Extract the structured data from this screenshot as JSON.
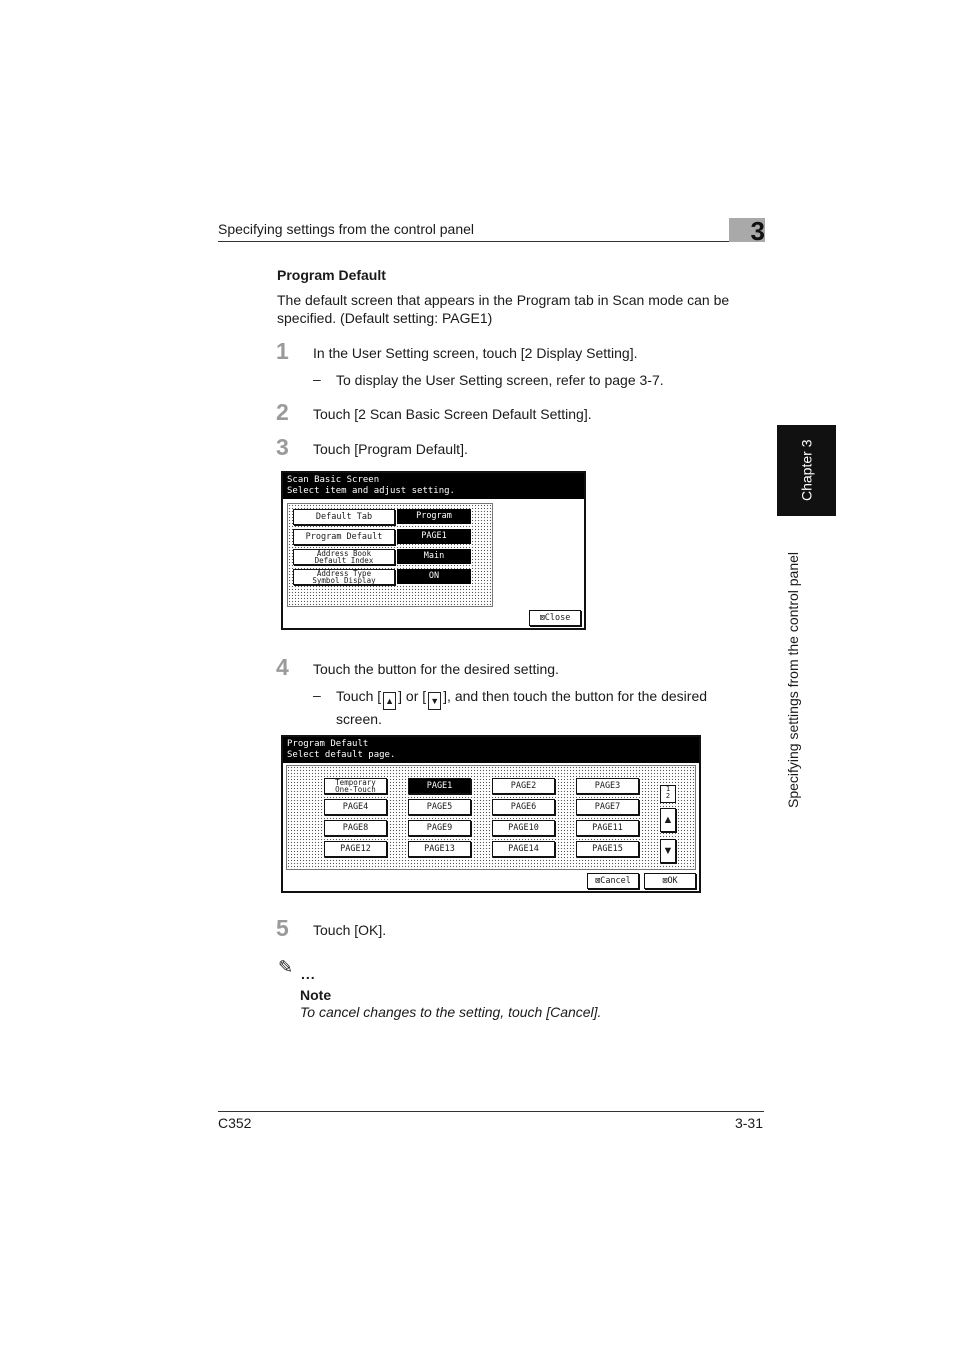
{
  "header": {
    "title": "Specifying settings from the control panel",
    "chapter_number": "3"
  },
  "side_tab": {
    "chapter_label": "Chapter 3",
    "section_label": "Specifying settings from the control panel"
  },
  "section": {
    "title": "Program Default",
    "intro": "The default screen that appears in the Program tab in Scan mode can be specified. (Default setting: PAGE1)"
  },
  "steps": [
    {
      "num": "1",
      "text": "In the User Setting screen, touch [2 Display Setting].",
      "sub": "To display the User Setting screen, refer to page 3-7."
    },
    {
      "num": "2",
      "text": "Touch [2 Scan Basic Screen Default Setting]."
    },
    {
      "num": "3",
      "text": "Touch [Program Default]."
    },
    {
      "num": "4",
      "text": "Touch the button for the desired setting.",
      "sub_a": "Touch [",
      "sub_b": "] or [",
      "sub_c": "], and then touch the button for the desired screen."
    },
    {
      "num": "5",
      "text": "Touch [OK]."
    }
  ],
  "screen1": {
    "title_line1": "Scan Basic Screen",
    "title_line2": "Select item and adjust setting.",
    "rows": [
      {
        "label": "Default Tab",
        "value": "Program"
      },
      {
        "label": "Program Default",
        "value": "PAGE1"
      },
      {
        "label_l1": "Address Book",
        "label_l2": "Default Index",
        "value": "Main"
      },
      {
        "label_l1": "Address Type",
        "label_l2": "Symbol Display",
        "value": "ON"
      }
    ],
    "close_label": "Close"
  },
  "screen2": {
    "title_line1": "Program Default",
    "title_line2": "Select default page.",
    "temp_l1": "Temporary",
    "temp_l2": "One-Touch",
    "pages": [
      "PAGE1",
      "PAGE2",
      "PAGE3",
      "PAGE4",
      "PAGE5",
      "PAGE6",
      "PAGE7",
      "PAGE8",
      "PAGE9",
      "PAGE10",
      "PAGE11",
      "PAGE12",
      "PAGE13",
      "PAGE14",
      "PAGE15"
    ],
    "selected": "PAGE1",
    "page_indicator_top": "1",
    "page_indicator_bottom": "2",
    "cancel_label": "Cancel",
    "ok_label": "OK"
  },
  "note": {
    "label": "Note",
    "text": "To cancel changes to the setting, touch [Cancel]."
  },
  "footer": {
    "model": "C352",
    "page": "3-31"
  },
  "icons": {
    "up": "up-arrow-icon",
    "down": "down-arrow-icon",
    "note": "pencil-icon"
  }
}
